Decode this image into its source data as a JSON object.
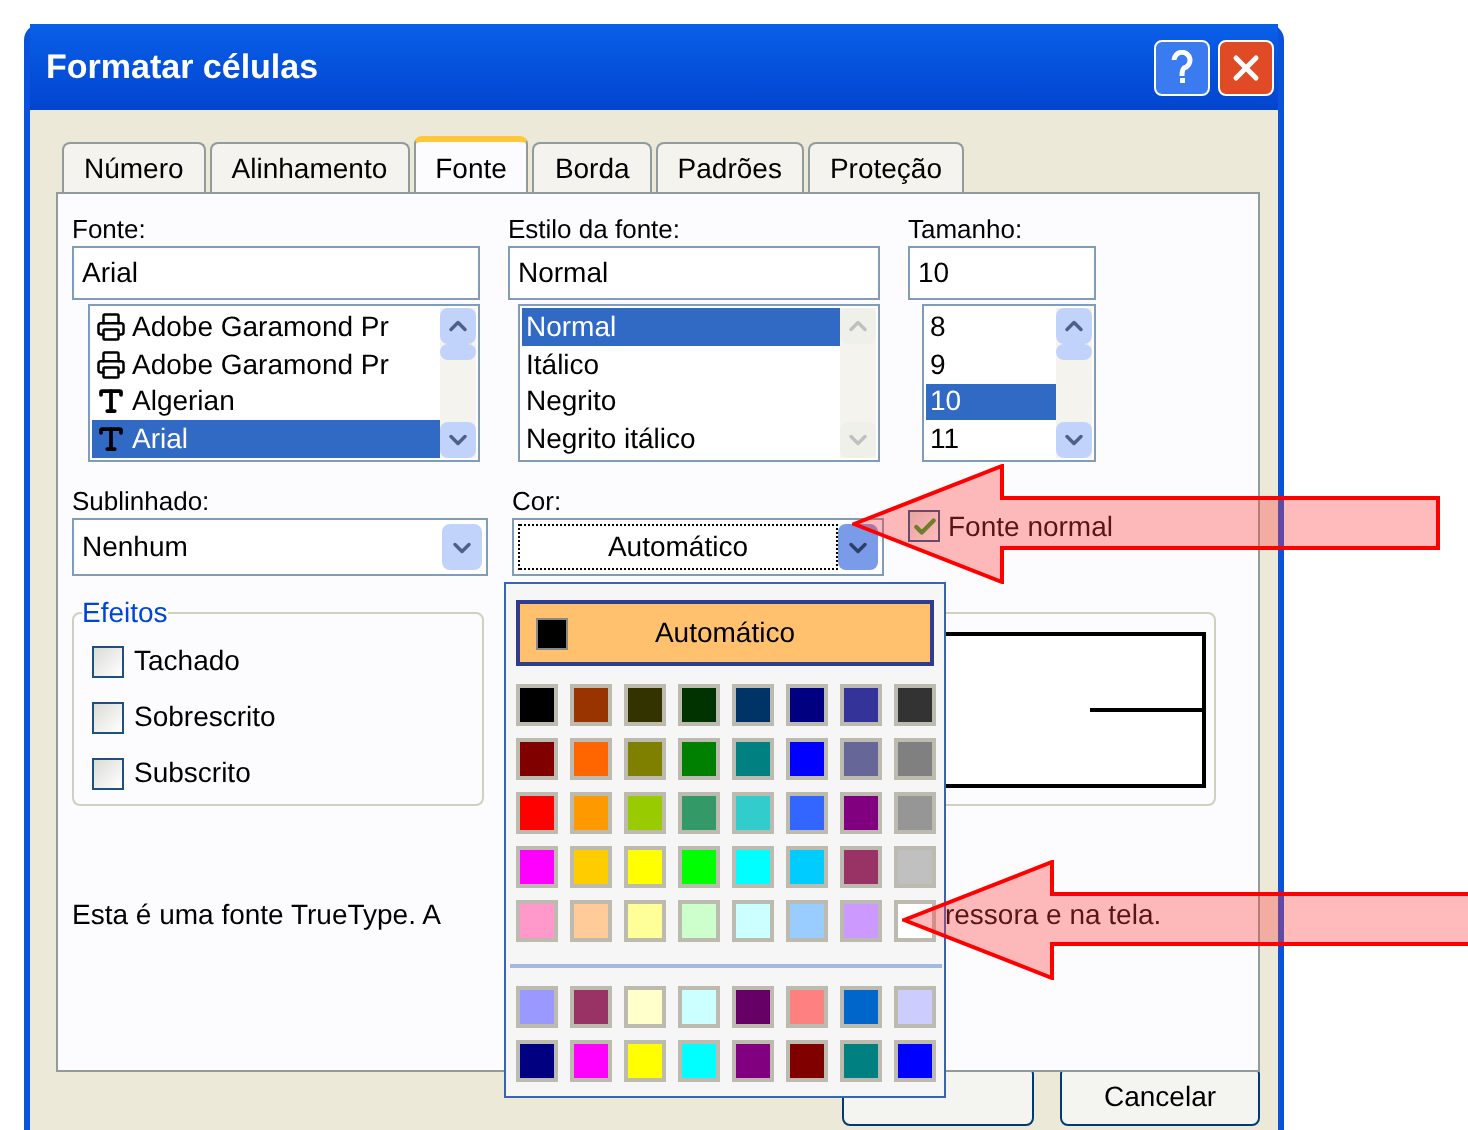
{
  "window": {
    "title": "Formatar células"
  },
  "tabs": [
    {
      "label": "Número",
      "selected": false
    },
    {
      "label": "Alinhamento",
      "selected": false
    },
    {
      "label": "Fonte",
      "selected": true
    },
    {
      "label": "Borda",
      "selected": false
    },
    {
      "label": "Padrões",
      "selected": false
    },
    {
      "label": "Proteção",
      "selected": false
    }
  ],
  "font": {
    "label": "Fonte:",
    "value": "Arial",
    "items": [
      {
        "label": "Adobe Garamond Pr",
        "kind": "printer",
        "selected": false
      },
      {
        "label": "Adobe Garamond Pr",
        "kind": "printer",
        "selected": false
      },
      {
        "label": "Algerian",
        "kind": "truetype",
        "selected": false
      },
      {
        "label": "Arial",
        "kind": "truetype",
        "selected": true
      }
    ]
  },
  "style": {
    "label": "Estilo da fonte:",
    "value": "Normal",
    "items": [
      {
        "label": "Normal",
        "selected": true
      },
      {
        "label": "Itálico",
        "selected": false
      },
      {
        "label": "Negrito",
        "selected": false
      },
      {
        "label": "Negrito itálico",
        "selected": false
      }
    ]
  },
  "size": {
    "label": "Tamanho:",
    "value": "10",
    "items": [
      {
        "label": "8",
        "selected": false
      },
      {
        "label": "9",
        "selected": false
      },
      {
        "label": "10",
        "selected": true
      },
      {
        "label": "11",
        "selected": false
      }
    ]
  },
  "underline": {
    "label": "Sublinhado:",
    "value": "Nenhum"
  },
  "color": {
    "label": "Cor:",
    "value": "Automático"
  },
  "normal_font": {
    "label": "Fonte normal",
    "checked": true
  },
  "effects": {
    "title": "Efeitos",
    "items": [
      {
        "label": "Tachado",
        "checked": false
      },
      {
        "label": "Sobrescrito",
        "checked": false
      },
      {
        "label": "Subscrito",
        "checked": false
      }
    ]
  },
  "description": [
    "Esta é uma fonte TrueType. A",
    "ressora e na tela."
  ],
  "buttons": [
    {
      "label": "Cancelar"
    }
  ],
  "color_popup": {
    "automatic_label": "Automático",
    "swatches": [
      {
        "color": "#000000"
      },
      {
        "color": "#993300"
      },
      {
        "color": "#333300"
      },
      {
        "color": "#003300"
      },
      {
        "color": "#003366"
      },
      {
        "color": "#000080"
      },
      {
        "color": "#333399"
      },
      {
        "color": "#333333"
      },
      {
        "color": "#800000"
      },
      {
        "color": "#ff6600"
      },
      {
        "color": "#808000"
      },
      {
        "color": "#008000"
      },
      {
        "color": "#008080"
      },
      {
        "color": "#0000ff"
      },
      {
        "color": "#666699"
      },
      {
        "color": "#808080"
      },
      {
        "color": "#ff0000"
      },
      {
        "color": "#ff9900"
      },
      {
        "color": "#99cc00"
      },
      {
        "color": "#339966"
      },
      {
        "color": "#33cccc"
      },
      {
        "color": "#3366ff"
      },
      {
        "color": "#800080"
      },
      {
        "color": "#969696"
      },
      {
        "color": "#ff00ff"
      },
      {
        "color": "#ffcc00"
      },
      {
        "color": "#ffff00"
      },
      {
        "color": "#00ff00"
      },
      {
        "color": "#00ffff"
      },
      {
        "color": "#00ccff"
      },
      {
        "color": "#993366"
      },
      {
        "color": "#c0c0c0"
      },
      {
        "color": "#ff99cc"
      },
      {
        "color": "#ffcc99"
      },
      {
        "color": "#ffff99"
      },
      {
        "color": "#ccffcc"
      },
      {
        "color": "#ccffff"
      },
      {
        "color": "#99ccff"
      },
      {
        "color": "#cc99ff"
      },
      {
        "color": "#ffffff"
      }
    ],
    "extra_swatches": [
      {
        "color": "#9999ff"
      },
      {
        "color": "#993366"
      },
      {
        "color": "#ffffcc"
      },
      {
        "color": "#ccffff"
      },
      {
        "color": "#660066"
      },
      {
        "color": "#ff8080"
      },
      {
        "color": "#0066cc"
      },
      {
        "color": "#ccccff"
      },
      {
        "color": "#000080"
      },
      {
        "color": "#ff00ff"
      },
      {
        "color": "#ffff00"
      },
      {
        "color": "#00ffff"
      },
      {
        "color": "#800080"
      },
      {
        "color": "#800000"
      },
      {
        "color": "#008080"
      },
      {
        "color": "#0000ff"
      }
    ]
  }
}
